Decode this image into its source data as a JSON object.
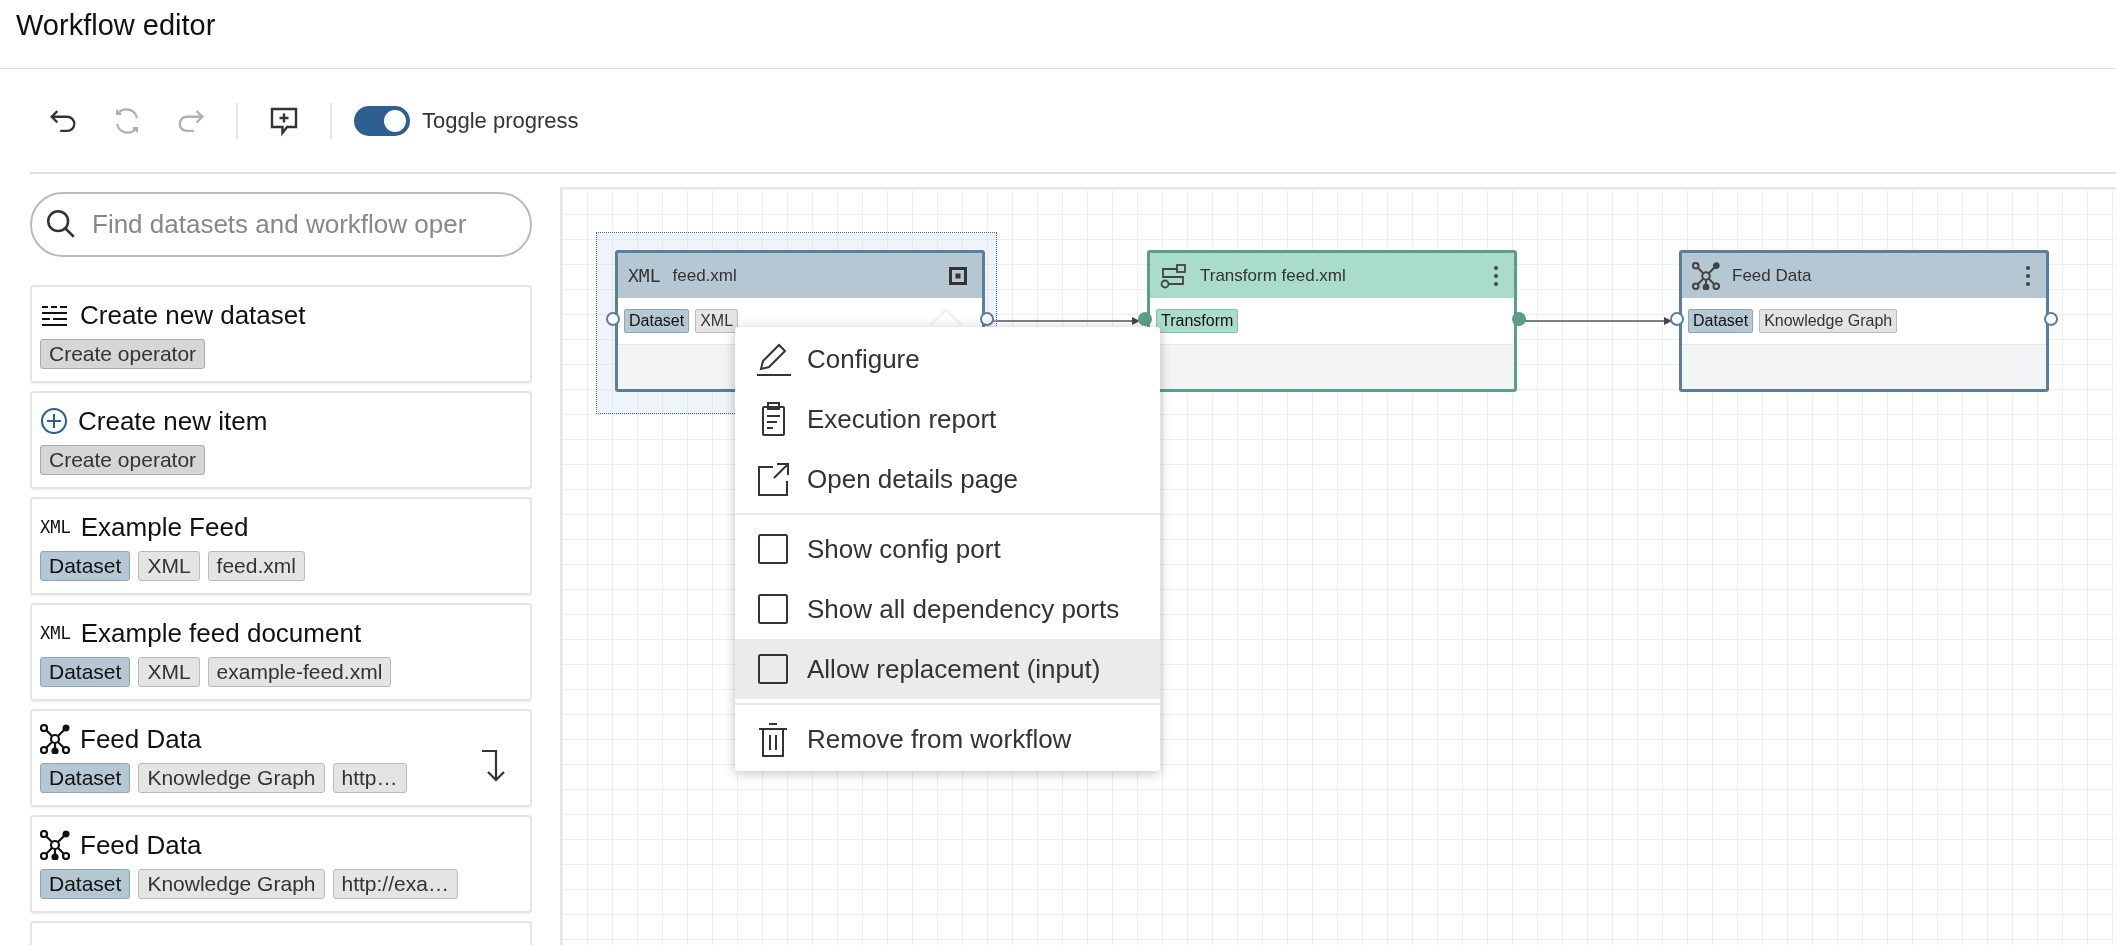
{
  "title": "Workflow editor",
  "toolbar": {
    "groups": [
      [
        {
          "kind": "undo",
          "disabled": false
        },
        {
          "kind": "refresh",
          "disabled": true
        },
        {
          "kind": "redo",
          "disabled": true
        }
      ],
      [
        {
          "kind": "comment",
          "disabled": false
        }
      ]
    ],
    "toggle": {
      "label": "Toggle progress",
      "on": true
    }
  },
  "search": {
    "placeholder": "Find datasets and workflow oper"
  },
  "sidebar": {
    "items": [
      {
        "kind": "form",
        "title": "Create new dataset",
        "hovered": false,
        "tags": [
          {
            "label": "Create operator",
            "kind": "operator"
          }
        ]
      },
      {
        "kind": "add",
        "title": "Create new item",
        "hovered": false,
        "tags": [
          {
            "label": "Create operator",
            "kind": "operator"
          }
        ]
      },
      {
        "kind": "xml",
        "icon_text": "XML",
        "title": "Example Feed",
        "hovered": false,
        "tags": [
          {
            "label": "Dataset",
            "kind": "type"
          },
          {
            "label": "XML",
            "kind": "plain"
          },
          {
            "label": "feed.xml",
            "kind": "plain"
          }
        ]
      },
      {
        "kind": "xml",
        "icon_text": "XML",
        "title": "Example feed document",
        "hovered": false,
        "tags": [
          {
            "label": "Dataset",
            "kind": "type"
          },
          {
            "label": "XML",
            "kind": "plain"
          },
          {
            "label": "example-feed.xml",
            "kind": "plain"
          }
        ]
      },
      {
        "kind": "graph",
        "title": "Feed Data",
        "hovered": true,
        "tags": [
          {
            "label": "Dataset",
            "kind": "type"
          },
          {
            "label": "Knowledge Graph",
            "kind": "plain"
          },
          {
            "label": "http…",
            "kind": "plain"
          }
        ]
      },
      {
        "kind": "graph",
        "title": "Feed Data",
        "hovered": false,
        "tags": [
          {
            "label": "Dataset",
            "kind": "type"
          },
          {
            "label": "Knowledge Graph",
            "kind": "plain"
          },
          {
            "label": "http://exa…",
            "kind": "plain"
          }
        ]
      }
    ]
  },
  "nodes": [
    {
      "kind": "xml",
      "icon_text": "XML",
      "title": "feed.xml",
      "selected": true,
      "menu_open": true,
      "tags": [
        {
          "label": "Dataset",
          "kind": "type"
        },
        {
          "label": "XML",
          "kind": "plain"
        }
      ]
    },
    {
      "kind": "transform",
      "title": "Transform feed.xml",
      "selected": false,
      "menu_open": false,
      "tags": [
        {
          "label": "Transform",
          "kind": "transform"
        }
      ]
    },
    {
      "kind": "graph",
      "title": "Feed Data",
      "selected": false,
      "menu_open": false,
      "tags": [
        {
          "label": "Dataset",
          "kind": "type"
        },
        {
          "label": "Knowledge Graph",
          "kind": "plain"
        }
      ]
    }
  ],
  "menu": {
    "groups": [
      [
        {
          "kind": "edit",
          "label": "Configure",
          "highlighted": false
        },
        {
          "kind": "report",
          "label": "Execution report",
          "highlighted": false
        },
        {
          "kind": "open",
          "label": "Open details page",
          "highlighted": false
        }
      ],
      [
        {
          "kind": "checkbox",
          "label": "Show config port",
          "checked": false,
          "highlighted": false
        },
        {
          "kind": "checkbox",
          "label": "Show all dependency ports",
          "checked": false,
          "highlighted": false
        },
        {
          "kind": "checkbox",
          "label": "Allow replacement (input)",
          "checked": false,
          "highlighted": true
        }
      ],
      [
        {
          "kind": "remove",
          "label": "Remove from workflow",
          "highlighted": false
        }
      ]
    ]
  }
}
